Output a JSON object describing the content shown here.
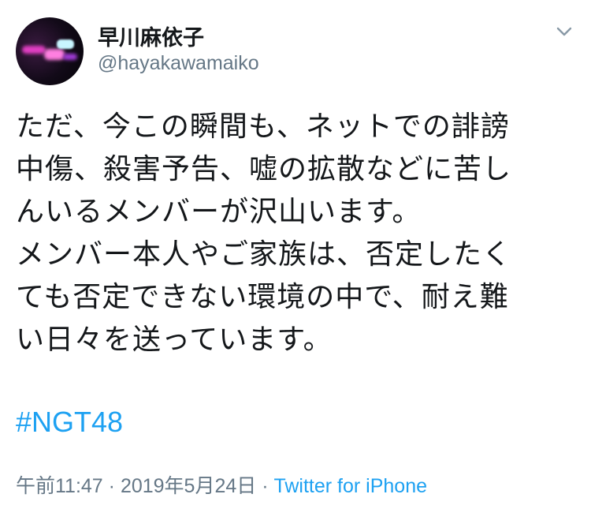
{
  "user": {
    "display_name": "早川麻依子",
    "handle": "@hayakawamaiko"
  },
  "menu": {
    "icon": "chevron-down-icon"
  },
  "tweet": {
    "lines": [
      "ただ、今この瞬間も、ネットでの誹謗",
      "中傷、殺害予告、嘘の拡散などに苦し",
      "んいるメンバーが沢山います。",
      "メンバー本人やご家族は、否定したく",
      "ても否定できない環境の中で、耐え難",
      "い日々を送っています。"
    ],
    "hashtag": "#NGT48"
  },
  "meta": {
    "time": "午前11:47",
    "separator1": " · ",
    "date": "2019年5月24日",
    "separator2": " · ",
    "source": "Twitter for iPhone"
  },
  "colors": {
    "link": "#1da1f2",
    "secondary": "#657786",
    "text": "#14171a"
  }
}
